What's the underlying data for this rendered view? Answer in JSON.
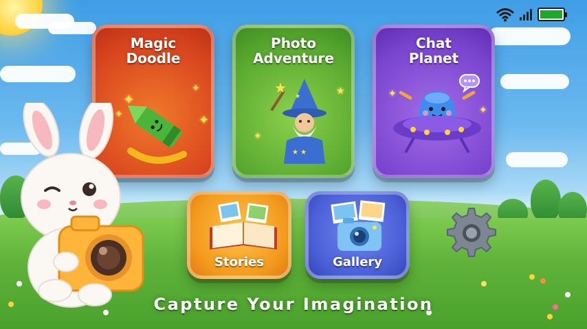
{
  "status": {
    "wifi_icon": "wifi-icon",
    "signal_icon": "signal-icon",
    "battery_icon": "battery-icon",
    "battery_level": 1.0,
    "battery_color": "#1fa62b"
  },
  "tiles": [
    {
      "title": "Magic\nDoodle",
      "icon": "crayon-icon",
      "color": "#d9451f"
    },
    {
      "title": "Photo\nAdventure",
      "icon": "wizard-icon",
      "color": "#58a82f"
    },
    {
      "title": "Chat\nPlanet",
      "icon": "alien-ufo-icon",
      "color": "#7a45cf"
    },
    {
      "title": "Stories",
      "icon": "storybook-icon",
      "color": "#f39a1d"
    },
    {
      "title": "Gallery",
      "icon": "photo-camera-icon",
      "color": "#4a5fd6"
    }
  ],
  "settings": {
    "icon": "gear-icon"
  },
  "mascot": {
    "icon": "bunny-with-camera-icon"
  },
  "tagline": "Capture Your Imagination"
}
